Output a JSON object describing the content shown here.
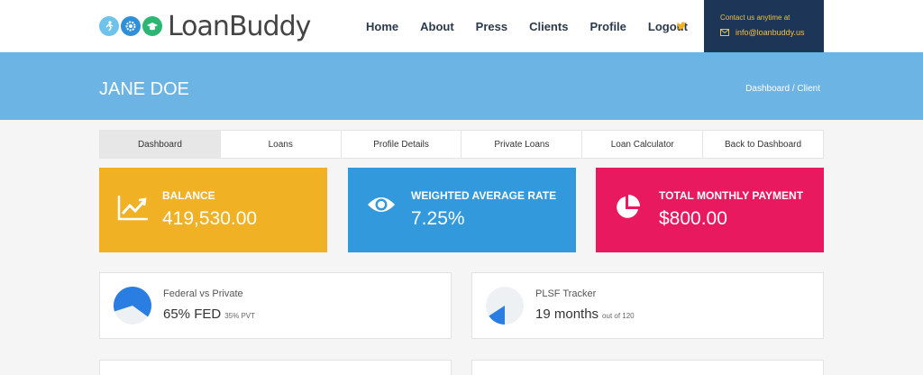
{
  "brand": {
    "name": "LoanBuddy"
  },
  "nav": {
    "items": [
      "Home",
      "About",
      "Press",
      "Clients",
      "Profile",
      "Logout"
    ]
  },
  "contact": {
    "label": "Contact us anytime at",
    "email": "info@loanbuddy.us"
  },
  "banner": {
    "title": "JANE DOE",
    "breadcrumb": "Dashboard  / Client"
  },
  "tabs": [
    "Dashboard",
    "Loans",
    "Profile Details",
    "Private Loans",
    "Loan Calculator",
    "Back to Dashboard"
  ],
  "cards": {
    "balance": {
      "label": "BALANCE",
      "value": "419,530.00"
    },
    "rate": {
      "label": "WEIGHTED AVERAGE RATE",
      "value": "7.25%"
    },
    "payment": {
      "label": "TOTAL MONTHLY PAYMENT",
      "value": "$800.00"
    }
  },
  "federal_vs_private": {
    "label": "Federal vs Private",
    "value": "65% FED",
    "sub": "35% PVT",
    "federal_fraction": 0.65
  },
  "plsf": {
    "label": "PLSF Tracker",
    "value": "19 months",
    "sub": "out of 120",
    "months_done": 19,
    "months_total": 120
  },
  "colors": {
    "balance": "#f0b124",
    "rate": "#3199dc",
    "payment": "#e8195f",
    "banner": "#6cb4e4",
    "contact_bg": "#1d3557",
    "accent": "#f0c040",
    "pie_fill": "#2a7de1",
    "pie_bg": "#eef1f4"
  }
}
